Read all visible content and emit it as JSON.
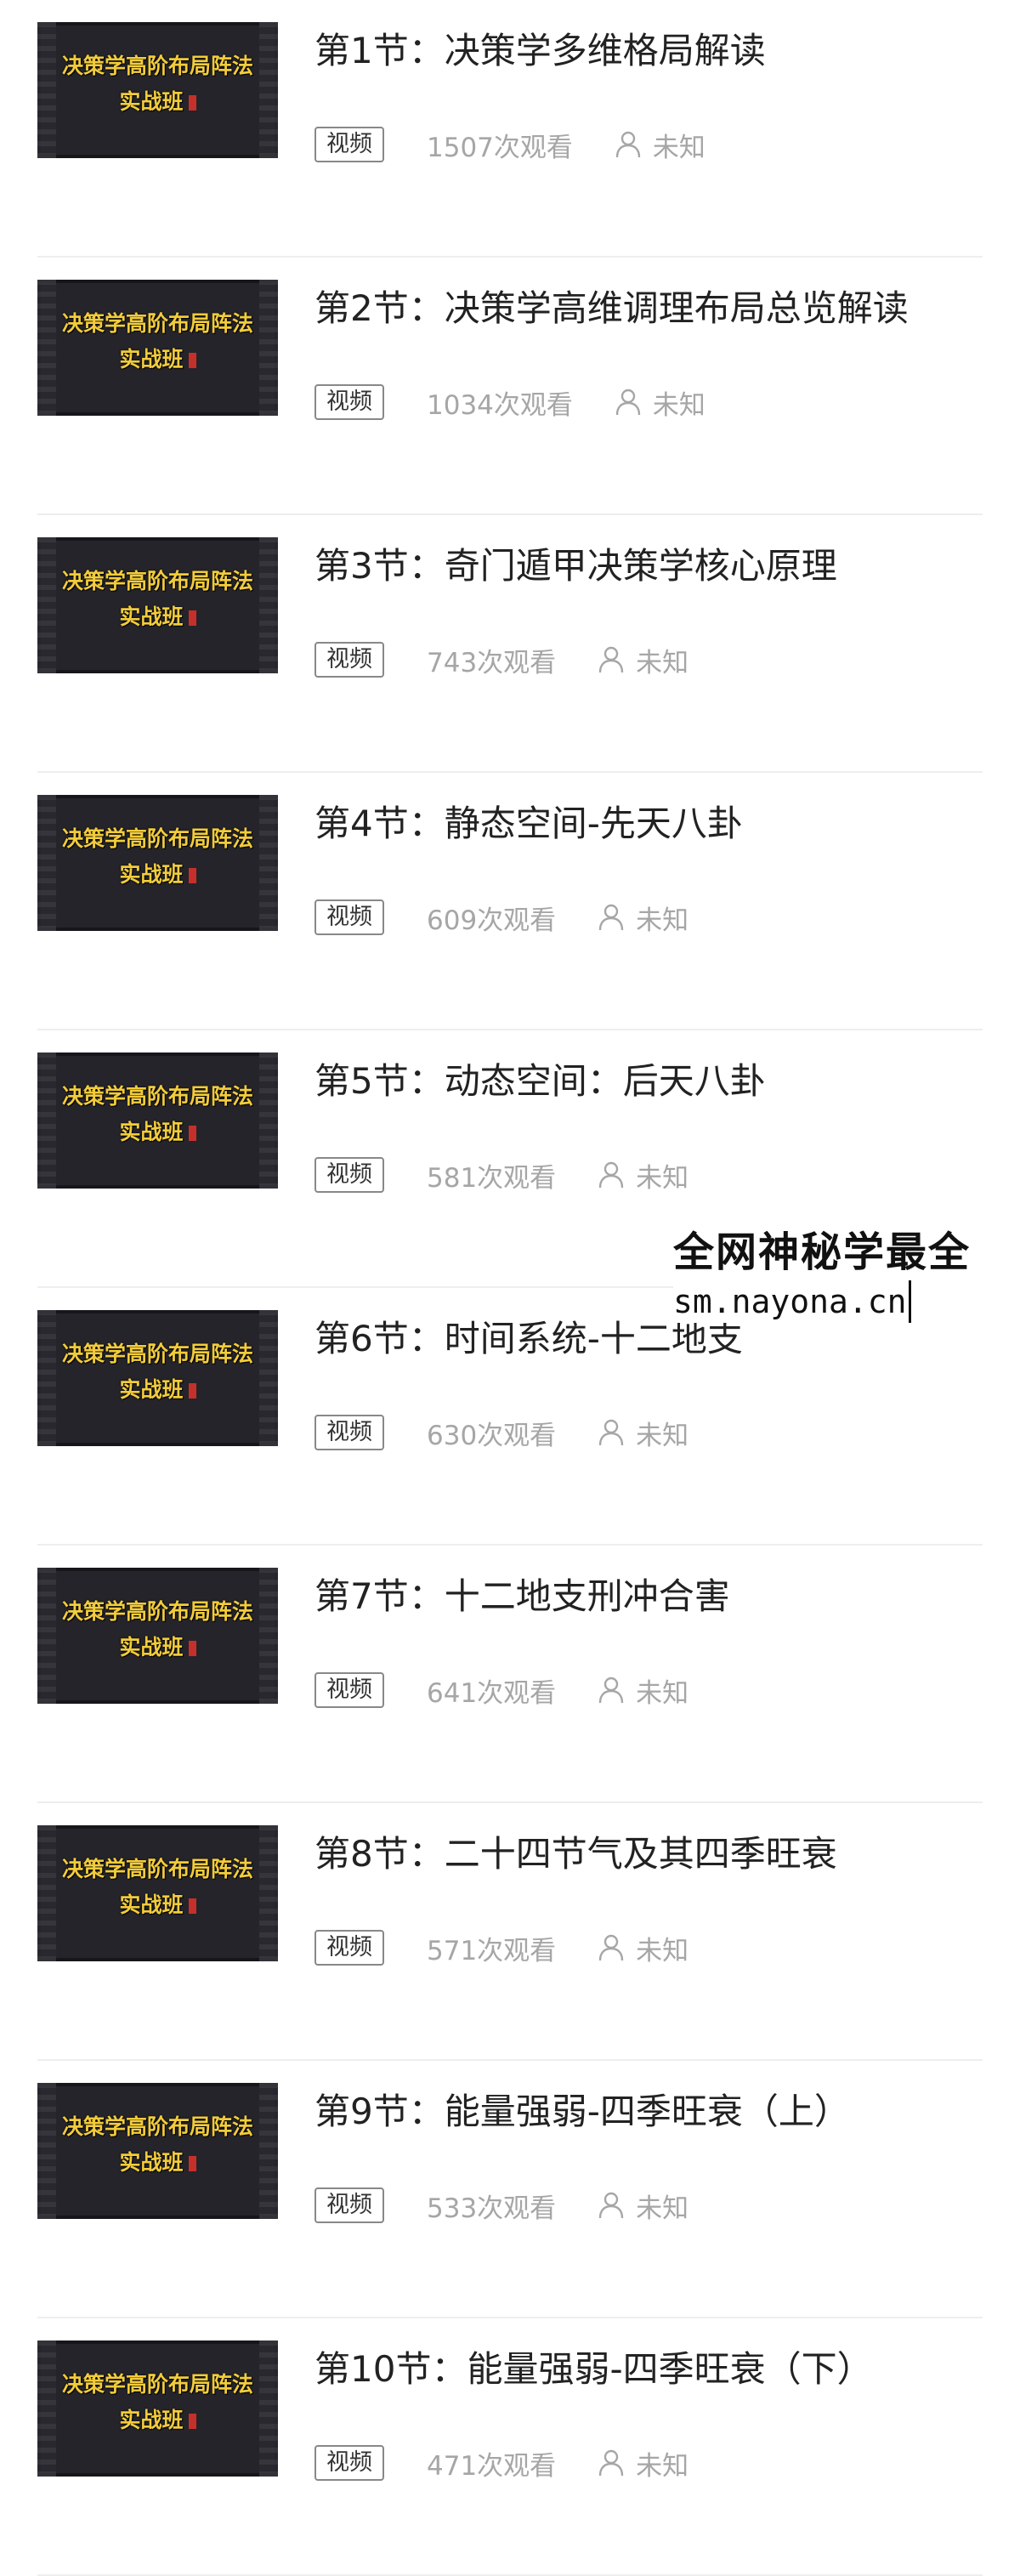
{
  "thumbnail": {
    "line1": "决策学高阶布局阵法",
    "line2": "实战班"
  },
  "lessons": [
    {
      "title": "第1节：决策学多维格局解读",
      "tag": "视频",
      "views": "1507次观看",
      "author": "未知"
    },
    {
      "title": "第2节：决策学高维调理布局总览解读",
      "tag": "视频",
      "views": "1034次观看",
      "author": "未知"
    },
    {
      "title": "第3节：奇门遁甲决策学核心原理",
      "tag": "视频",
      "views": "743次观看",
      "author": "未知"
    },
    {
      "title": "第4节：静态空间-先天八卦",
      "tag": "视频",
      "views": "609次观看",
      "author": "未知"
    },
    {
      "title": "第5节：动态空间：后天八卦",
      "tag": "视频",
      "views": "581次观看",
      "author": "未知"
    },
    {
      "title": "第6节：时间系统-十二地支",
      "tag": "视频",
      "views": "630次观看",
      "author": "未知"
    },
    {
      "title": "第7节：十二地支刑冲合害",
      "tag": "视频",
      "views": "641次观看",
      "author": "未知"
    },
    {
      "title": "第8节：二十四节气及其四季旺衰",
      "tag": "视频",
      "views": "571次观看",
      "author": "未知"
    },
    {
      "title": "第9节：能量强弱-四季旺衰（上）",
      "tag": "视频",
      "views": "533次观看",
      "author": "未知"
    },
    {
      "title": "第10节：能量强弱-四季旺衰（下）",
      "tag": "视频",
      "views": "471次观看",
      "author": "未知"
    }
  ],
  "watermark": {
    "line1": "全网神秘学最全",
    "line2": "sm.nayona.cn"
  },
  "colors": {
    "thumb_bg": "#25242a",
    "thumb_text": "#f2cc3c",
    "meta_text": "#a6a6a6",
    "title_text": "#222222"
  },
  "icons": {
    "author": "user-icon"
  }
}
